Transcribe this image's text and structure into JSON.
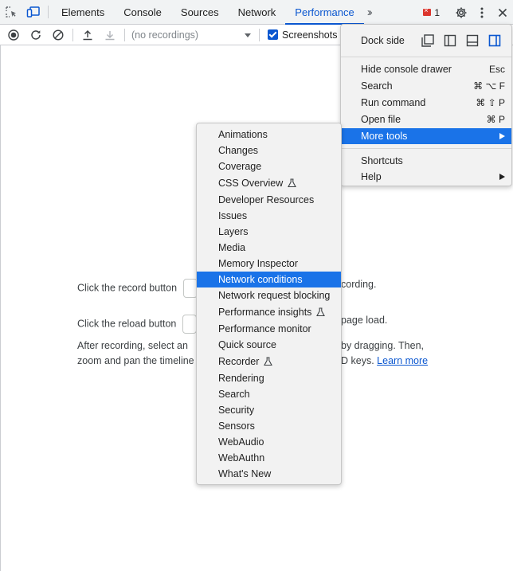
{
  "tabs": [
    {
      "label": "Elements"
    },
    {
      "label": "Console"
    },
    {
      "label": "Sources"
    },
    {
      "label": "Network"
    },
    {
      "label": "Performance"
    }
  ],
  "error_count": "1",
  "toolbar": {
    "recordings_placeholder": "(no recordings)",
    "screenshots_label": "Screenshots"
  },
  "landing": {
    "record_text_start": "Click the record button",
    "record_text_end": "cording.",
    "reload_text_start": "Click the reload button",
    "reload_text_end": "page load.",
    "after_line1_start": "After recording, select an",
    "after_line1_end": "by dragging. Then,",
    "after_line2_start": "zoom and pan the timeline",
    "after_line2_end": "D keys.",
    "learn_more": "Learn more"
  },
  "main_menu": {
    "dock_side_label": "Dock side",
    "items": [
      {
        "label": "Hide console drawer",
        "shortcut": "Esc"
      },
      {
        "label": "Search",
        "shortcut": "⌘ ⌥ F"
      },
      {
        "label": "Run command",
        "shortcut": "⌘ ⇧ P"
      },
      {
        "label": "Open file",
        "shortcut": "⌘ P"
      },
      {
        "label": "More tools",
        "shortcut": ""
      }
    ],
    "items2": [
      {
        "label": "Shortcuts"
      },
      {
        "label": "Help"
      }
    ]
  },
  "more_tools": [
    {
      "label": "Animations"
    },
    {
      "label": "Changes"
    },
    {
      "label": "Coverage"
    },
    {
      "label": "CSS Overview"
    },
    {
      "label": "Developer Resources"
    },
    {
      "label": "Issues"
    },
    {
      "label": "Layers"
    },
    {
      "label": "Media"
    },
    {
      "label": "Memory Inspector"
    },
    {
      "label": "Network conditions"
    },
    {
      "label": "Network request blocking"
    },
    {
      "label": "Performance insights"
    },
    {
      "label": "Performance monitor"
    },
    {
      "label": "Quick source"
    },
    {
      "label": "Recorder"
    },
    {
      "label": "Rendering"
    },
    {
      "label": "Search"
    },
    {
      "label": "Security"
    },
    {
      "label": "Sensors"
    },
    {
      "label": "WebAudio"
    },
    {
      "label": "WebAuthn"
    },
    {
      "label": "What's New"
    }
  ],
  "colors": {
    "accent": "#0b57d0",
    "highlight": "#1a73e8",
    "error": "#dc362e"
  }
}
